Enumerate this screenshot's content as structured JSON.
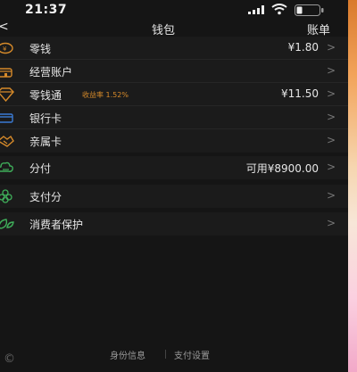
{
  "status_bar": {
    "time": "21:37"
  },
  "nav": {
    "back": "<",
    "title": "钱包",
    "bill": "账单"
  },
  "rows": {
    "change": {
      "label": "零钱",
      "value": "¥1.80",
      "chevron": ">"
    },
    "business": {
      "label": "经营账户",
      "chevron": ">"
    },
    "lct": {
      "label": "零钱通",
      "rate": "收益率 1.52%",
      "value": "¥11.50",
      "chevron": ">"
    },
    "bank_card": {
      "label": "银行卡",
      "chevron": ">"
    },
    "family_card": {
      "label": "亲属卡",
      "chevron": ">"
    },
    "fenfu": {
      "label": "分付",
      "value": "可用¥8900.00",
      "chevron": ">"
    },
    "zhifufen": {
      "label": "支付分",
      "chevron": ">"
    },
    "protection": {
      "label": "消费者保护",
      "chevron": ">"
    }
  },
  "footer": {
    "identity": "身份信息",
    "settings": "支付设置"
  },
  "copyright_mark": "©",
  "colors": {
    "background": "#151515",
    "row": "#1b1b1b",
    "orange": "#d68a2a",
    "green": "#3fae5a",
    "blue": "#3b7bd4"
  },
  "icons": [
    "coin-icon",
    "store-icon",
    "diamond-icon",
    "card-icon",
    "handshake-icon",
    "cloud-icon",
    "flower-icon",
    "leaf-icon"
  ]
}
